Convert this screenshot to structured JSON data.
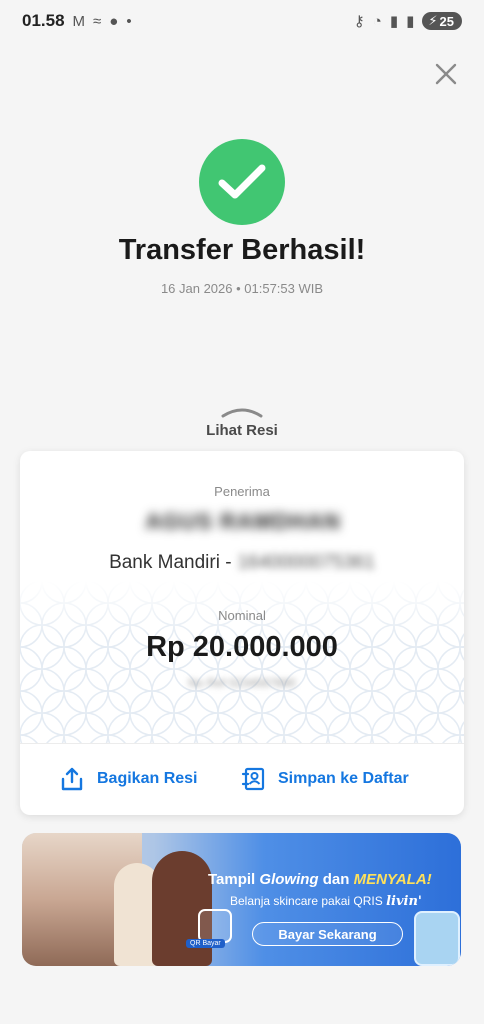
{
  "status_bar": {
    "time": "01.58",
    "notif_icons": [
      "gmail-icon",
      "wind-icon",
      "chat-icon",
      "dot-icon"
    ],
    "system_icons": [
      "key-icon",
      "wifi-icon",
      "signal-icon",
      "signal-icon"
    ],
    "battery": "25"
  },
  "header": {
    "close_icon": "close-icon"
  },
  "result": {
    "icon": "check-icon",
    "title": "Transfer Berhasil!",
    "datetime": "16 Jan 2026 • 01:57:53 WIB"
  },
  "toggle": {
    "label": "Lihat Resi"
  },
  "receipt": {
    "penerima_label": "Penerima",
    "recipient_name": "AGUS RAMDHAN",
    "bank": "Bank Mandiri -",
    "account": "1640000075361",
    "nominal_label": "Nominal",
    "amount": "Rp 20.000.000",
    "reference": "No Ref 0234567890"
  },
  "actions": {
    "share_label": "Bagikan Resi",
    "save_label": "Simpan ke Daftar"
  },
  "banner": {
    "title_part1": "Tampil",
    "title_italic": "Glowing",
    "title_part2": "dan",
    "title_highlight": "MENYALA!",
    "subtitle": "Belanja skincare pakai QRIS",
    "brand": "livin'",
    "qr_label": "QR Bayar",
    "button_label": "Bayar Sekarang"
  },
  "colors": {
    "success": "#41c672",
    "accent": "#1577e0",
    "background": "#f5f5f5"
  }
}
